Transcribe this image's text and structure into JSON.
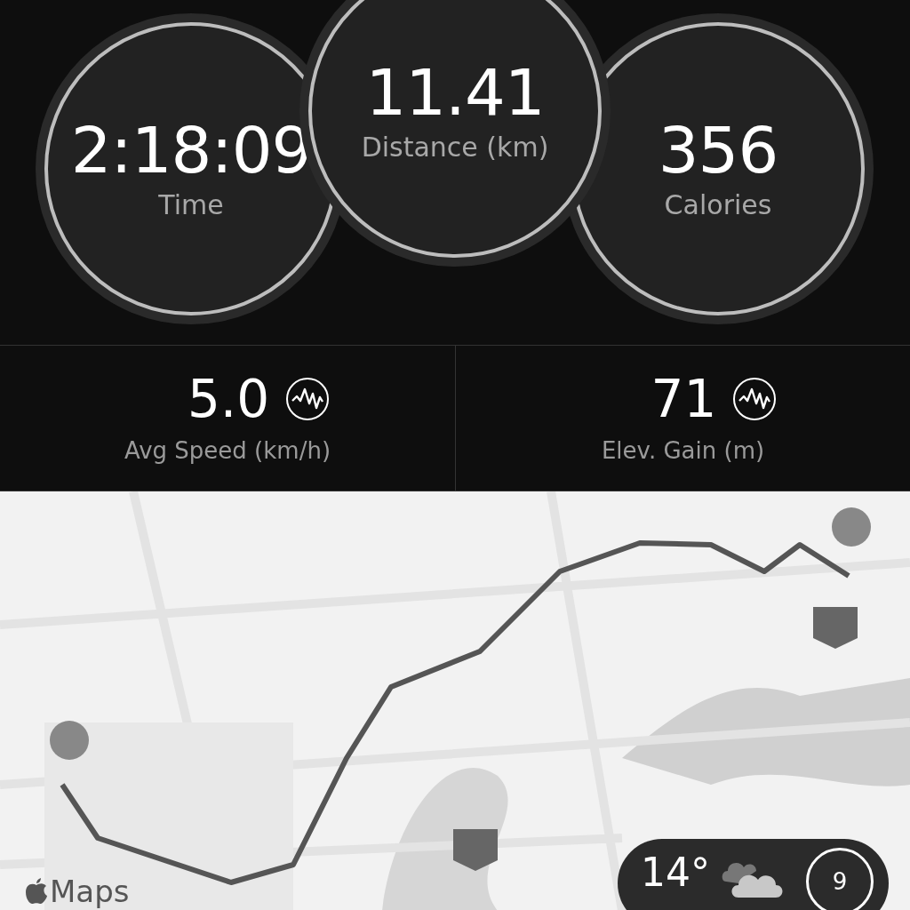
{
  "rings": [
    {
      "value": "2:18:09",
      "label": "Time"
    },
    {
      "value": "11.41",
      "label": "Distance (km)"
    },
    {
      "value": "356",
      "label": "Calories"
    }
  ],
  "stats": [
    {
      "value": "5.0",
      "label": "Avg Speed (km/h)"
    },
    {
      "value": "71",
      "label": "Elev. Gain (m)"
    }
  ],
  "map": {
    "kind": "picture",
    "attribution": "Maps",
    "weather": {
      "temperature": "14°",
      "index": "9"
    }
  }
}
